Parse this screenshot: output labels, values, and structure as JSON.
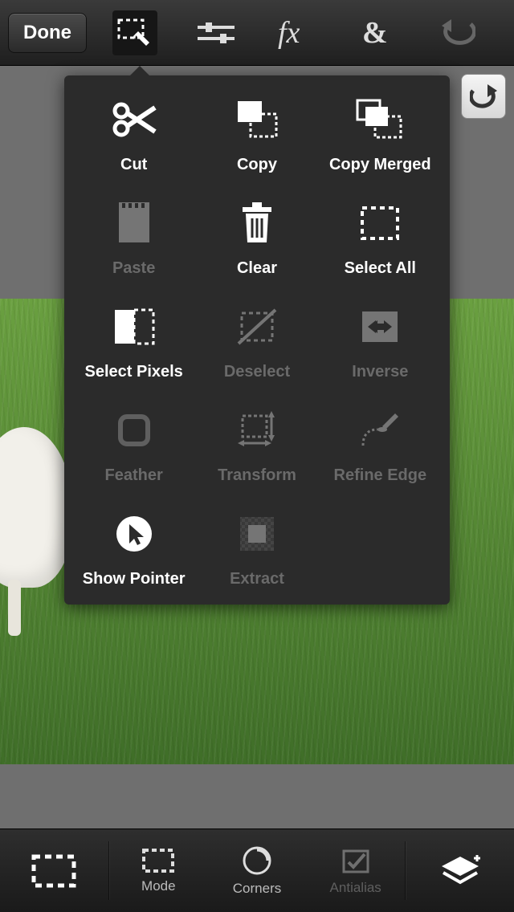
{
  "toolbar": {
    "done_label": "Done"
  },
  "popup": {
    "items": [
      {
        "id": "cut",
        "label": "Cut",
        "enabled": true
      },
      {
        "id": "copy",
        "label": "Copy",
        "enabled": true
      },
      {
        "id": "copy-merged",
        "label": "Copy Merged",
        "enabled": true
      },
      {
        "id": "paste",
        "label": "Paste",
        "enabled": false
      },
      {
        "id": "clear",
        "label": "Clear",
        "enabled": true
      },
      {
        "id": "select-all",
        "label": "Select All",
        "enabled": true
      },
      {
        "id": "select-pixels",
        "label": "Select Pixels",
        "enabled": true
      },
      {
        "id": "deselect",
        "label": "Deselect",
        "enabled": false
      },
      {
        "id": "inverse",
        "label": "Inverse",
        "enabled": false
      },
      {
        "id": "feather",
        "label": "Feather",
        "enabled": false
      },
      {
        "id": "transform",
        "label": "Transform",
        "enabled": false
      },
      {
        "id": "refine-edge",
        "label": "Refine Edge",
        "enabled": false
      },
      {
        "id": "show-pointer",
        "label": "Show Pointer",
        "enabled": true
      },
      {
        "id": "extract",
        "label": "Extract",
        "enabled": false
      }
    ]
  },
  "bottom": {
    "mode_label": "Mode",
    "corners_label": "Corners",
    "antialias_label": "Antialias"
  }
}
